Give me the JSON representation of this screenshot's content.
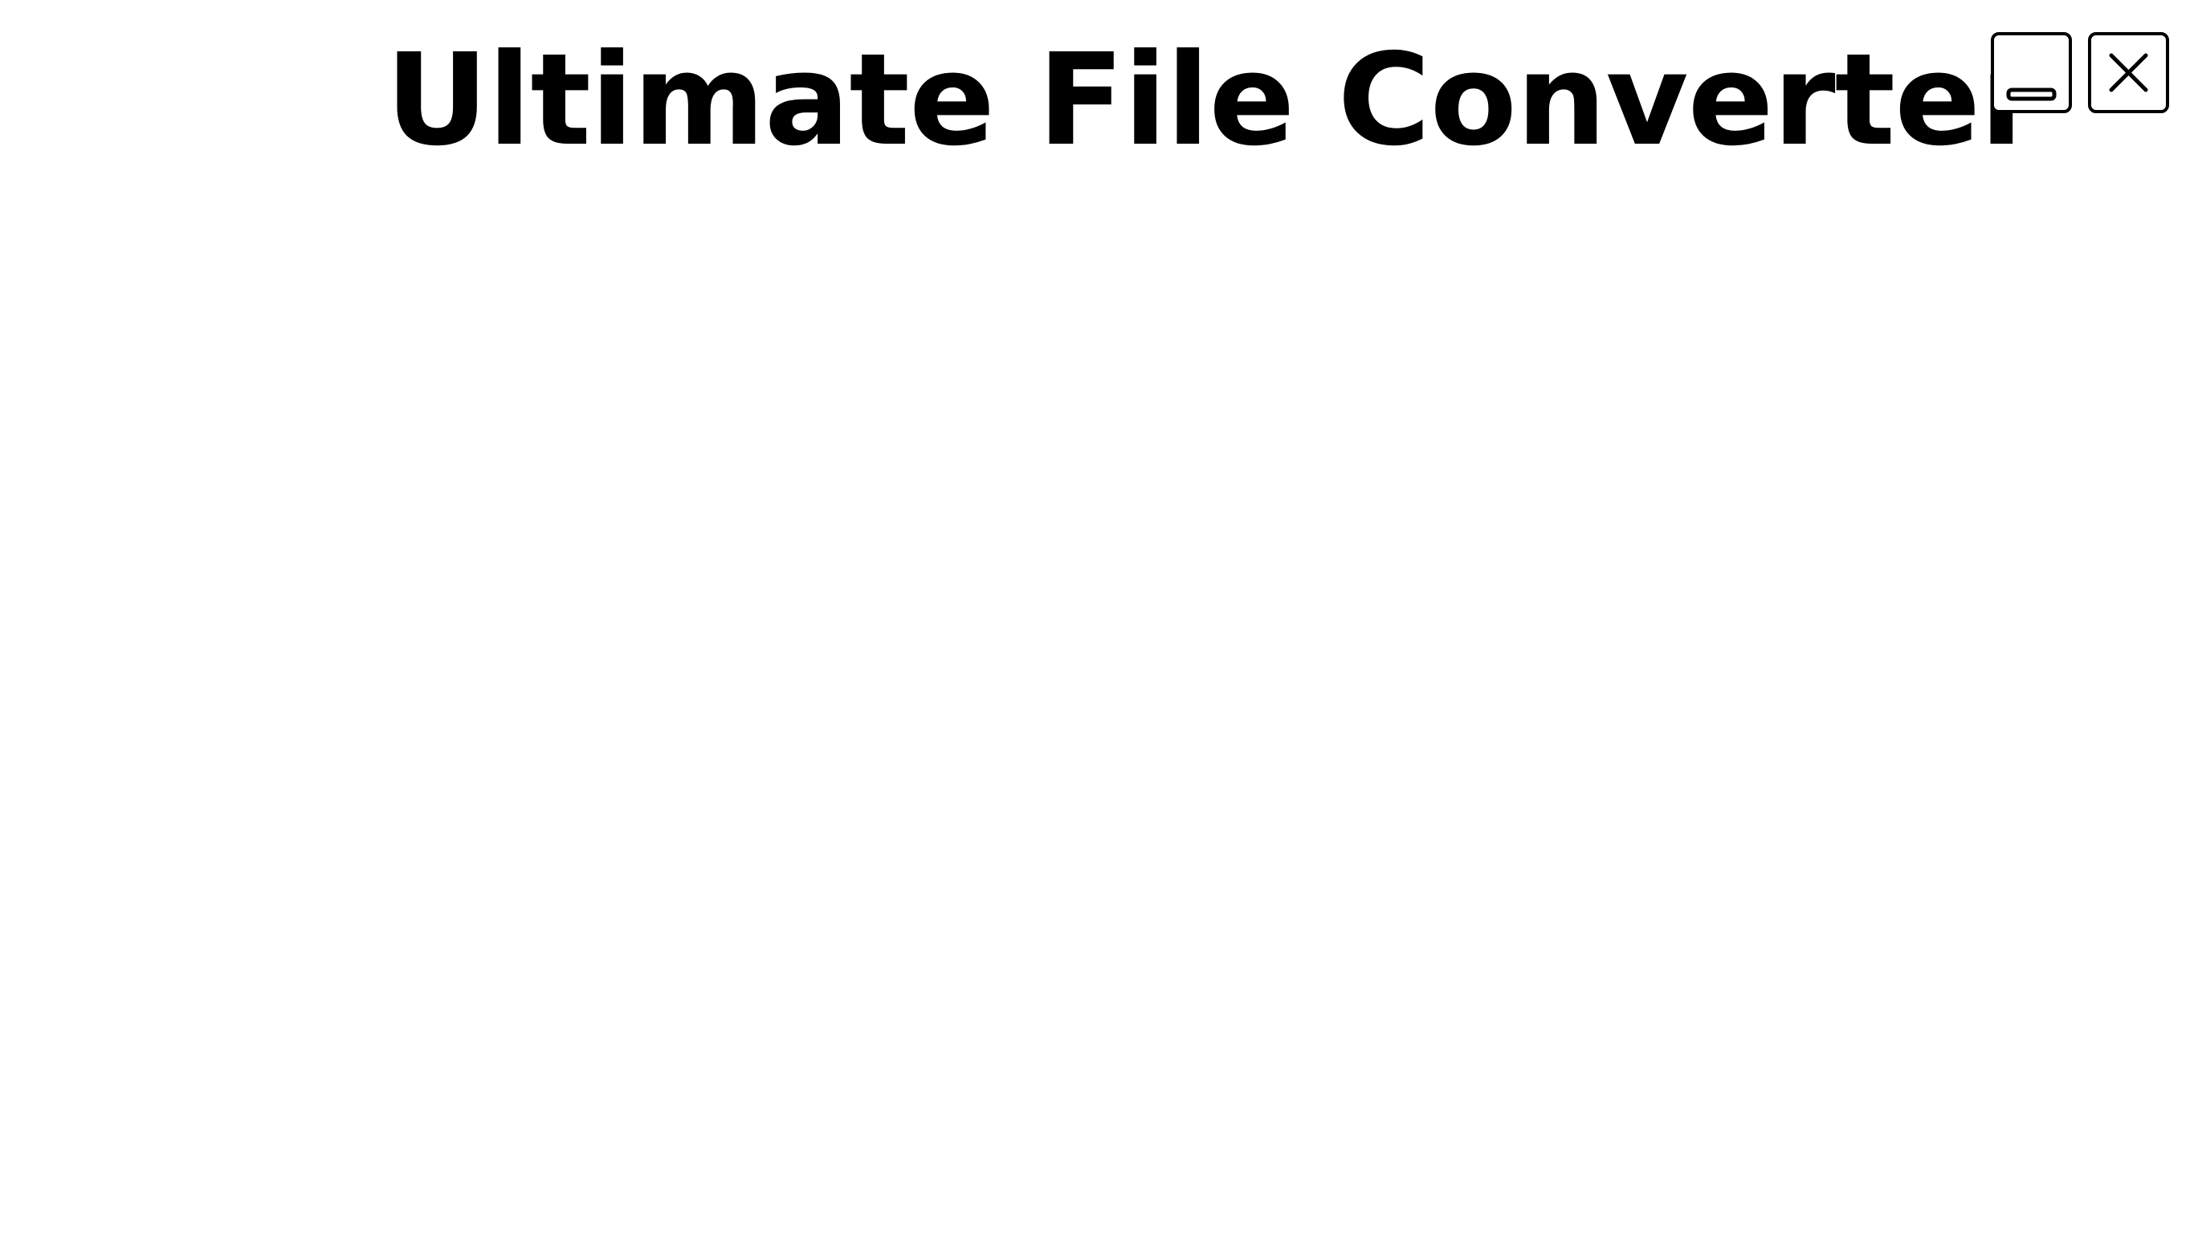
{
  "window": {
    "title": "Ultimate File Converter"
  },
  "controls": {
    "minimize_icon": "minimize-icon",
    "close_icon": "close-icon"
  },
  "colors": {
    "background": "#ffffff",
    "foreground": "#000000"
  }
}
